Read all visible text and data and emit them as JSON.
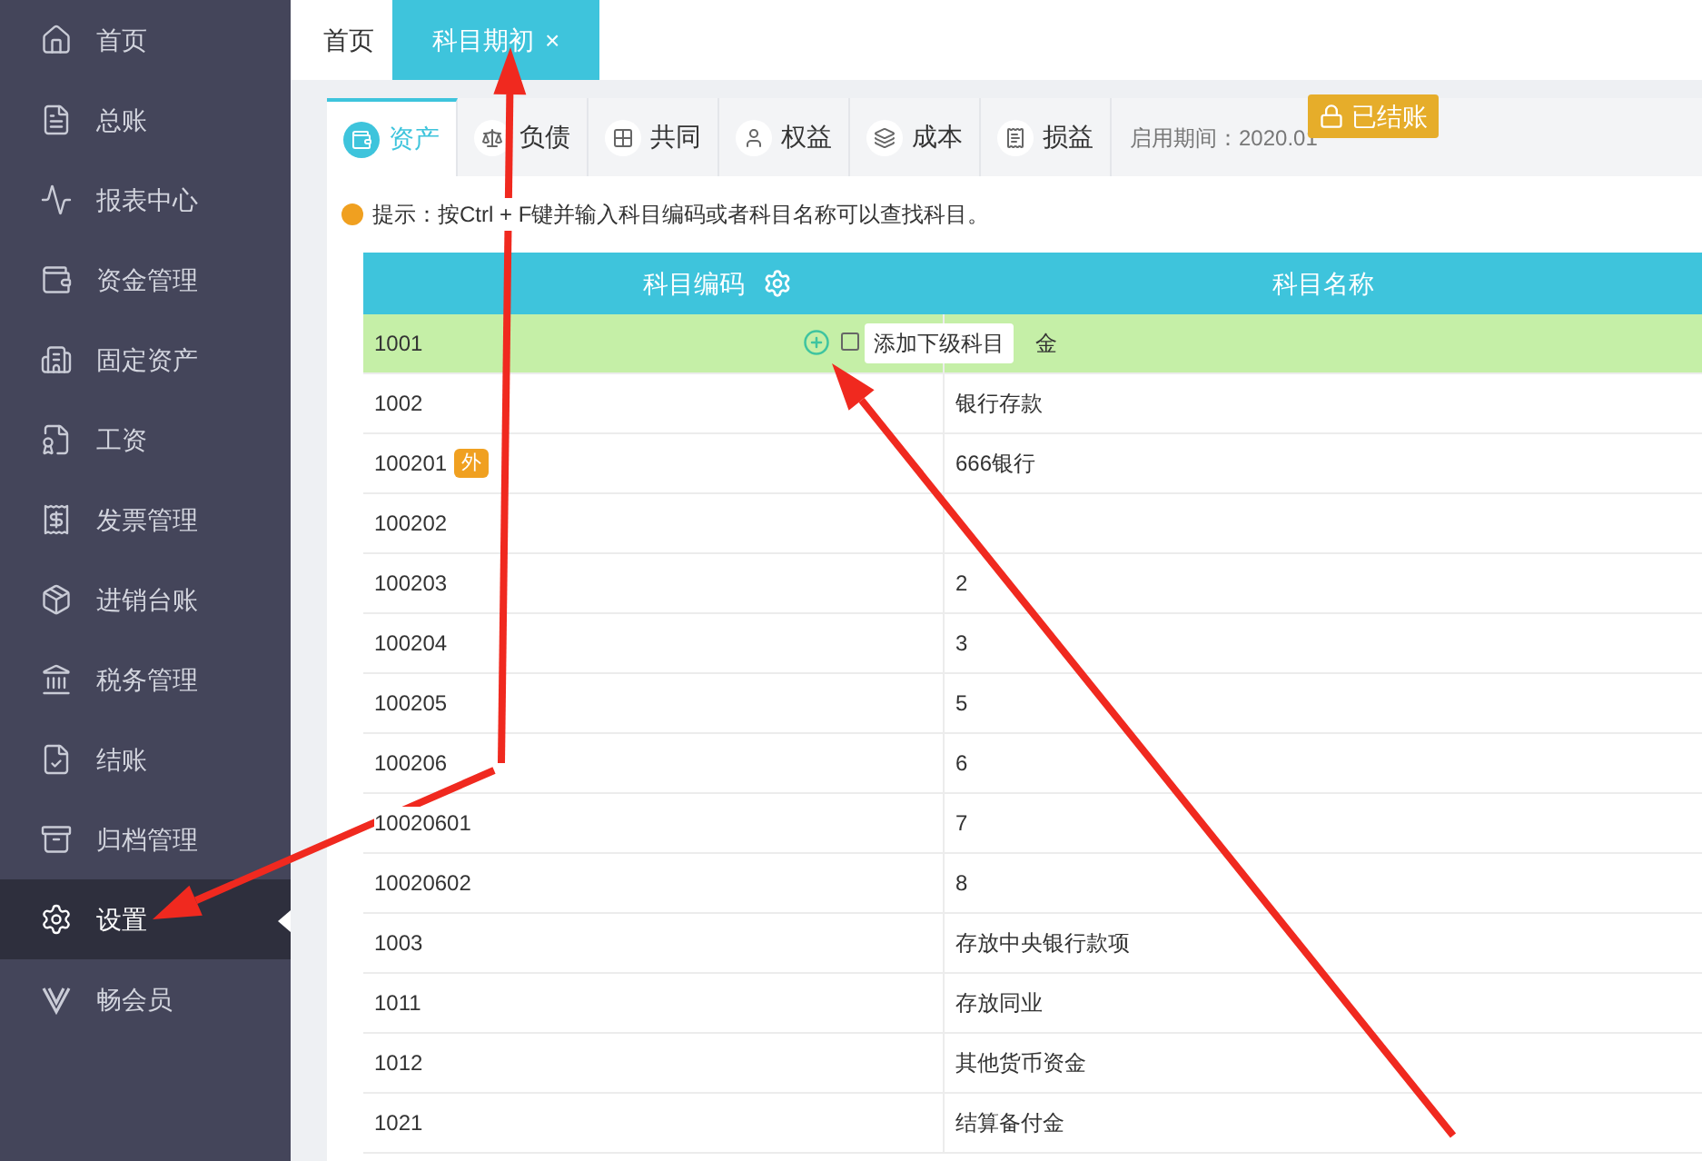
{
  "sidebar": {
    "items": [
      {
        "label": "首页",
        "selected": false
      },
      {
        "label": "总账",
        "selected": false
      },
      {
        "label": "报表中心",
        "selected": false
      },
      {
        "label": "资金管理",
        "selected": false
      },
      {
        "label": "固定资产",
        "selected": false
      },
      {
        "label": "工资",
        "selected": false
      },
      {
        "label": "发票管理",
        "selected": false
      },
      {
        "label": "进销台账",
        "selected": false
      },
      {
        "label": "税务管理",
        "selected": false
      },
      {
        "label": "结账",
        "selected": false
      },
      {
        "label": "归档管理",
        "selected": false
      },
      {
        "label": "设置",
        "selected": true
      },
      {
        "label": "畅会员",
        "selected": false
      }
    ]
  },
  "page_tabs": [
    {
      "label": "首页",
      "selected": false
    },
    {
      "label": "科目期初",
      "selected": true,
      "close": "×"
    }
  ],
  "category_tabs": [
    {
      "label": "资产",
      "selected": true
    },
    {
      "label": "负债",
      "selected": false
    },
    {
      "label": "共同",
      "selected": false
    },
    {
      "label": "权益",
      "selected": false
    },
    {
      "label": "成本",
      "selected": false
    },
    {
      "label": "损益",
      "selected": false
    }
  ],
  "start_period": "启用期间：2020.01",
  "closed_badge": "已结账",
  "hint": "提示：按Ctrl + F键并输入科目编码或者科目名称可以查找科目。",
  "table": {
    "columns": [
      "科目编码",
      "科目名称"
    ],
    "rows": [
      {
        "code": "1001",
        "name": "金",
        "selected": true,
        "tooltip": "添加下级科目"
      },
      {
        "code": "1002",
        "name": "银行存款",
        "selected": false
      },
      {
        "code": "100201",
        "tag": "外",
        "name": "666银行",
        "selected": false
      },
      {
        "code": "100202",
        "selected": false
      },
      {
        "code": "100203",
        "name": "2",
        "selected": false
      },
      {
        "code": "100204",
        "name": "3",
        "selected": false
      },
      {
        "code": "100205",
        "name": "5",
        "selected": false
      },
      {
        "code": "100206",
        "name": "6",
        "selected": false
      },
      {
        "code": "10020601",
        "name": "7",
        "selected": false
      },
      {
        "code": "10020602",
        "name": "8",
        "selected": false
      },
      {
        "code": "1003",
        "name": "存放中央银行款项",
        "selected": false
      },
      {
        "code": "1011",
        "name": "存放同业",
        "selected": false
      },
      {
        "code": "1012",
        "name": "其他货币资金",
        "selected": false
      },
      {
        "code": "1021",
        "name": "结算备付金",
        "selected": false
      }
    ]
  }
}
